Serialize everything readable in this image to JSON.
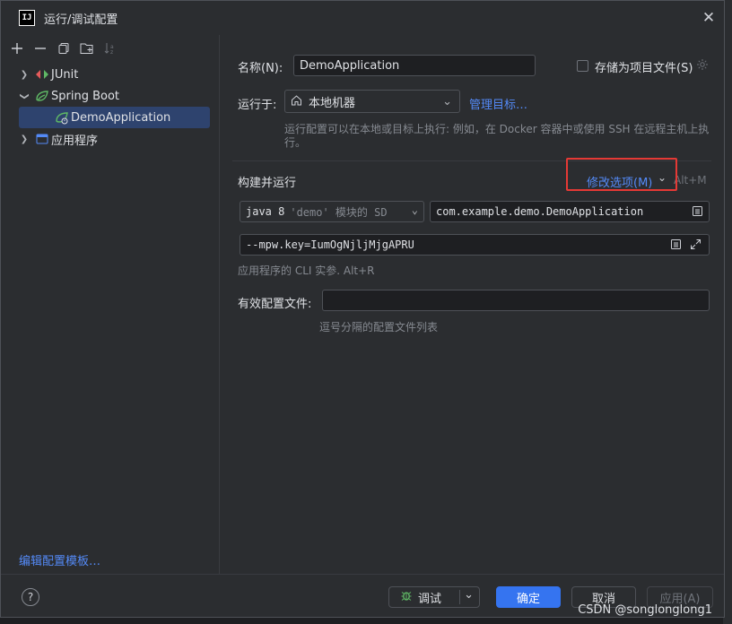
{
  "window": {
    "title": "运行/调试配置",
    "logo_text": "IJ"
  },
  "toolbar": {
    "add": "+",
    "remove": "−",
    "copy": "⧉",
    "folder": "📁",
    "sort": "↓ª"
  },
  "tree": {
    "items": [
      {
        "label": "JUnit",
        "icon": "junit-icon",
        "expanded": false
      },
      {
        "label": "Spring Boot",
        "icon": "spring-boot-icon",
        "expanded": true
      },
      {
        "label": "DemoApplication",
        "icon": "spring-boot-run-icon",
        "selected": true
      },
      {
        "label": "应用程序",
        "icon": "application-icon",
        "expanded": false
      }
    ]
  },
  "edit_templates_link": "编辑配置模板…",
  "form": {
    "name_label": "名称(N):",
    "name_value": "DemoApplication",
    "store_label": "存储为项目文件(S)",
    "run_on_label": "运行于:",
    "run_on_value": "本地机器",
    "manage_targets_link": "管理目标…",
    "run_on_hint": "运行配置可以在本地或目标上执行: 例如，在 Docker 容器中或使用 SSH 在远程主机上执行。",
    "build_run_label": "构建并运行",
    "modify_options_link": "修改选项(M)",
    "modify_options_shortcut": "Alt+M",
    "jdk_value": "java 8",
    "jdk_suffix": "'demo' 模块的 SD",
    "main_class_value": "com.example.demo.DemoApplication",
    "program_args_value": "--mpw.key=IumOgNjljMjgAPRU",
    "program_args_hint": "应用程序的 CLI 实参. Alt+R",
    "active_profiles_label": "有效配置文件:",
    "active_profiles_value": "",
    "active_profiles_hint": "逗号分隔的配置文件列表"
  },
  "footer": {
    "help": "?",
    "debug_label": "调试",
    "ok_label": "确定",
    "cancel_label": "取消",
    "apply_label": "应用(A)"
  },
  "watermark": "CSDN @songlonglong1",
  "colors": {
    "accent": "#3574f0",
    "link": "#548af7",
    "highlight_box": "#e53935",
    "selection": "#2e436e"
  }
}
